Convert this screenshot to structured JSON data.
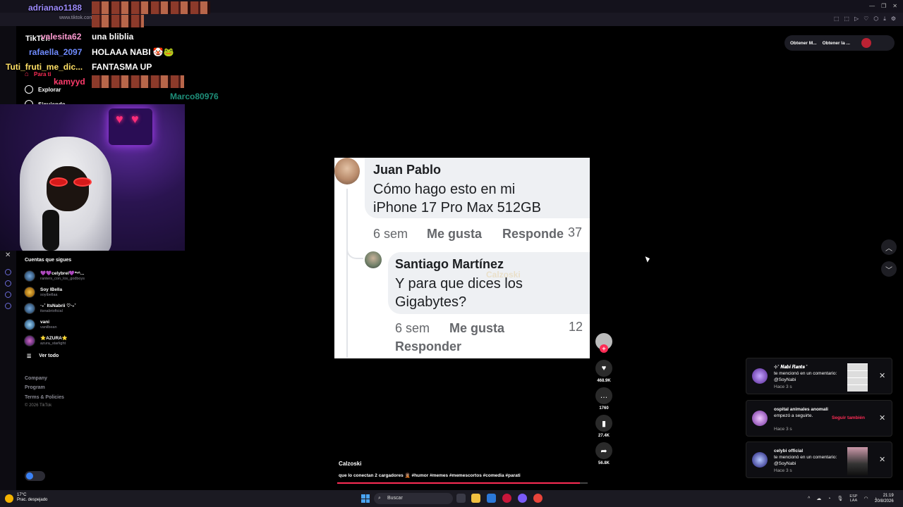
{
  "browser": {
    "url": "www.tiktok.com",
    "window_controls": [
      "—",
      "❐",
      "✕"
    ]
  },
  "sidebar": {
    "logo": "TikTok",
    "nav": [
      {
        "label": "Para ti",
        "icon": "home-icon"
      },
      {
        "label": "Explorar",
        "icon": "compass-icon"
      },
      {
        "label": "Siguiendo",
        "icon": "following-icon"
      }
    ],
    "close": "✕",
    "following_title": "Cuentas que sigues",
    "following": [
      {
        "name": "💜💜celybrel💜*ᵛᴬ...",
        "handle": "ranters_con_los_godboys"
      },
      {
        "name": "Soy lBella",
        "handle": "soyibellaa"
      },
      {
        "name": "‧₊˚ ItsNabrii ♡‧₊˚",
        "handle": "itsnabrioficial"
      },
      {
        "name": "vani",
        "handle": "vanilbean"
      },
      {
        "name": "⭐AZURA⭐",
        "handle": "azura_starlight"
      }
    ],
    "see_all": "Ver todo",
    "footer": [
      "Company",
      "Program",
      "Terms & Policies"
    ],
    "copyright": "© 2026 TikTok"
  },
  "chat": [
    {
      "user": "adrianao1188",
      "message": "",
      "user_color": "#9f8cff"
    },
    {
      "user": "valesita62",
      "message": "una bliblia",
      "user_color": "#ff9bd2"
    },
    {
      "user": "rafaella_2097",
      "message": "HOLAAA NABI 🤡🐸",
      "user_color": "#6f8bff"
    },
    {
      "user": "Tuti_fruti_me_dic...",
      "message": "FANTASMA UP",
      "user_color": "#ffe066"
    },
    {
      "user": "kamyyd",
      "message": "",
      "user_color": "#ff3b6b"
    },
    {
      "user": "Marco80976",
      "message": "",
      "user_color": "#1e8f7a"
    }
  ],
  "top_actions": {
    "button1": "Obtener M...",
    "button2": "Obtener la ..."
  },
  "video": {
    "comment1": {
      "name": "Juan Pablo",
      "line1": "Cómo hago esto en mi",
      "line2": "iPhone 17 Pro Max 512GB",
      "time": "6 sem",
      "like": "Me gusta",
      "reply": "Responde",
      "likes": "37"
    },
    "comment2": {
      "name": "Santiago Martínez",
      "line1": "Y para que dices los",
      "line2": "Gigabytes?",
      "time": "6 sem",
      "like": "Me gusta",
      "reply": "Responder",
      "likes": "12"
    },
    "watermark": "Calzoski",
    "caption_user": "Calzoski",
    "caption": "que lo conectan 2 cargadores 🤦🏽 #humor #memes #memescortos #comedia #parati",
    "progress": 0.97
  },
  "actions": {
    "likes": "468.9K",
    "comments": "1760",
    "saves": "27.4K",
    "shares": "56.8K"
  },
  "notifications": [
    {
      "title": "⊹˚ 𝑵𝒂𝒃𝒊 𝑹𝒂𝒏𝒕𝒔 ˚",
      "text": "te mencionó en un comentario: @SoyNabi",
      "time": "Hace 3 s"
    },
    {
      "title": "ospital animales anomali",
      "text": "empezó a seguirte.",
      "time": "Hace 3 s",
      "action": "Seguir también"
    },
    {
      "title": "celybi official",
      "text": "te mencionó en un comentario: @SoyNabi",
      "time": "Hace 3 s"
    }
  ],
  "taskbar": {
    "weather_temp": "17°C",
    "weather_desc": "Prac. despejado",
    "search": "Buscar",
    "lang1": "ESP",
    "lang2": "LAA",
    "time": "21:19",
    "date": "20/8/2026"
  },
  "colors": {
    "accent": "#fe2c55",
    "background": "#000000"
  }
}
